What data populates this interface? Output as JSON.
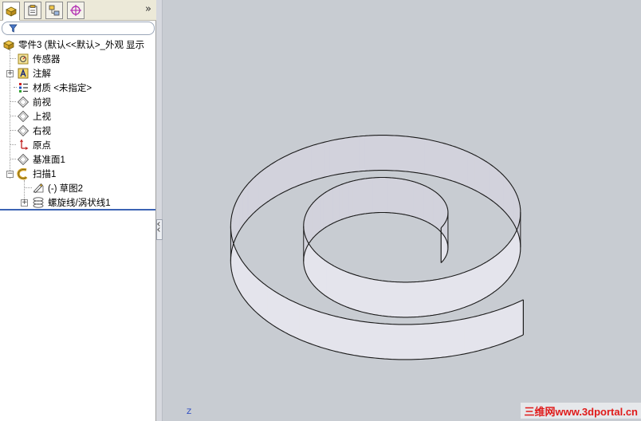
{
  "toolbar": {
    "tabs": [
      "feature-manager",
      "property-manager",
      "configuration-manager",
      "dim-xpert-manager"
    ],
    "more_label": "»"
  },
  "filter": {
    "icon": "filter-icon"
  },
  "tree": {
    "root": "零件3  (默认<<默认>_外观 显示",
    "items": [
      {
        "label": "传感器",
        "icon": "sensor-icon"
      },
      {
        "label": "注解",
        "icon": "annotation-icon"
      },
      {
        "label": "材质 <未指定>",
        "icon": "material-icon"
      },
      {
        "label": "前视",
        "icon": "plane-icon"
      },
      {
        "label": "上视",
        "icon": "plane-icon"
      },
      {
        "label": "右视",
        "icon": "plane-icon"
      },
      {
        "label": "原点",
        "icon": "origin-icon"
      },
      {
        "label": "基准面1",
        "icon": "plane-icon"
      },
      {
        "label": "扫描1",
        "icon": "sweep-icon"
      },
      {
        "label": "(-) 草图2",
        "icon": "sketch-icon"
      },
      {
        "label": "螺旋线/涡状线1",
        "icon": "helix-icon"
      }
    ]
  },
  "viewport": {
    "axis_label": "Z",
    "watermark": "三维网www.3dportal.cn",
    "background": "#c8ccd2",
    "surface_color": "#e4e4ec"
  },
  "colors": {
    "accent": "#3c64b4",
    "watermark": "#e01a1a"
  }
}
